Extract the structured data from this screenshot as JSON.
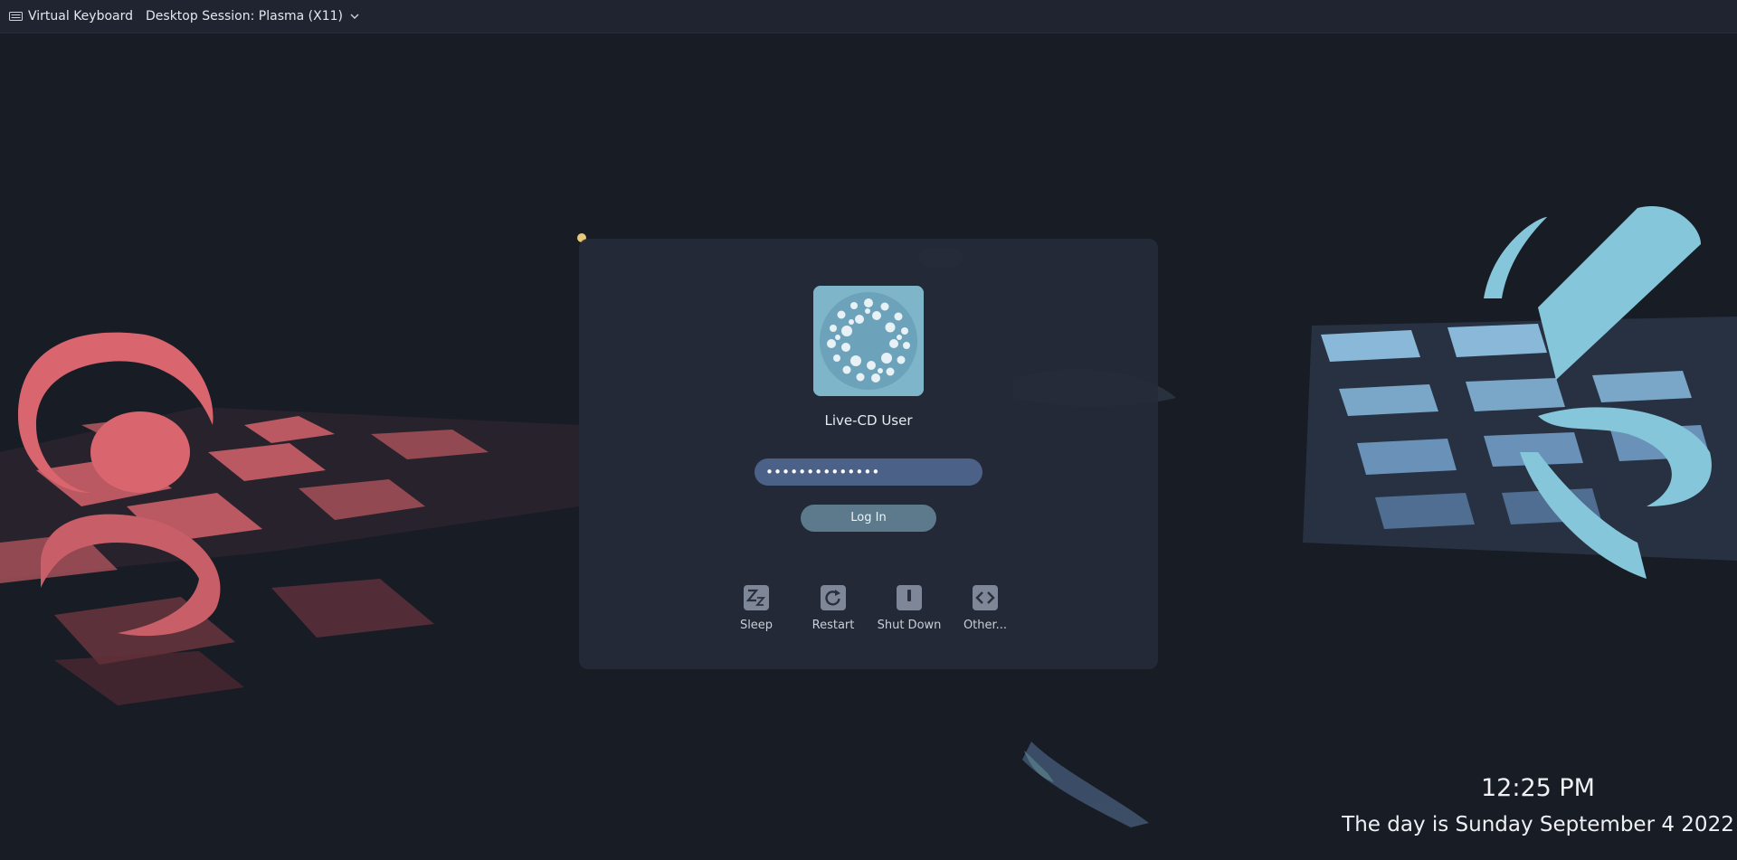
{
  "topbar": {
    "virtual_keyboard_label": "Virtual Keyboard",
    "session_label": "Desktop Session: Plasma (X11)"
  },
  "login": {
    "user_name": "Live-CD User",
    "password_value": "••••••••••••••",
    "login_button_label": "Log In"
  },
  "power_actions": [
    {
      "label": "Sleep",
      "icon": "sleep-icon"
    },
    {
      "label": "Restart",
      "icon": "restart-icon"
    },
    {
      "label": "Shut Down",
      "icon": "shutdown-icon"
    },
    {
      "label": "Other...",
      "icon": "other-icon"
    }
  ],
  "clock": {
    "time": "12:25 PM",
    "date": "The day is Sunday September 4 2022"
  },
  "colors": {
    "background": "#181c25",
    "card": "#252a37",
    "accent_blue": "#4b6187",
    "wallpaper_red": "#e06a72",
    "wallpaper_cyan": "#86c6da"
  }
}
